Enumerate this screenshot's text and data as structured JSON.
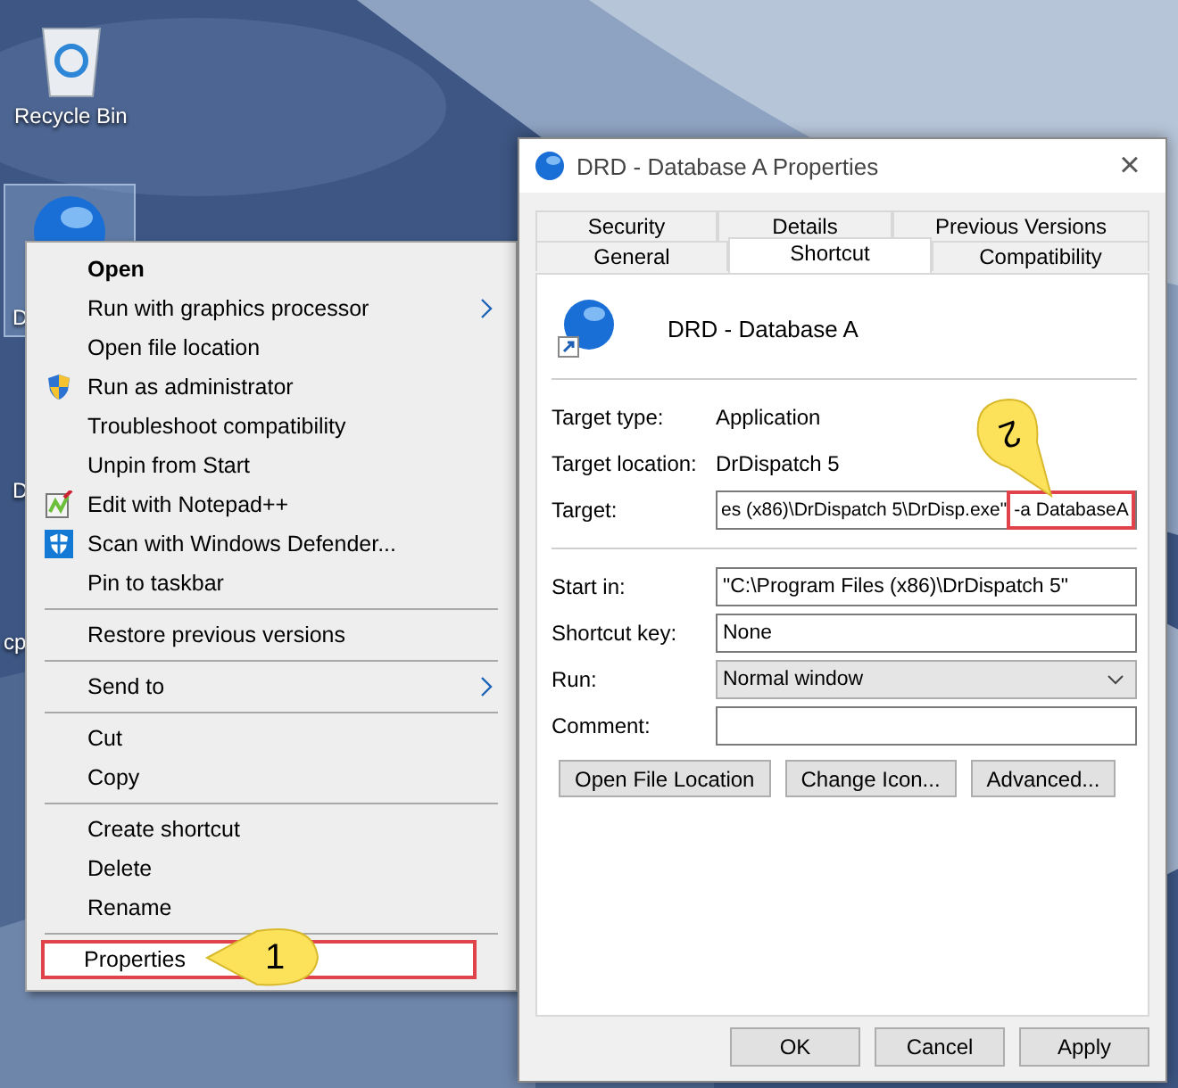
{
  "desktop": {
    "icons": [
      {
        "label": "Recycle Bin",
        "kind": "recycle"
      },
      {
        "label": "D",
        "kind": "drd",
        "selected": true
      },
      {
        "label": "D",
        "kind": "hidden"
      },
      {
        "label": "cp",
        "kind": "hidden"
      }
    ]
  },
  "context_menu": {
    "items": [
      {
        "kind": "item",
        "label": "Open",
        "default": true
      },
      {
        "kind": "item",
        "label": "Run with graphics processor",
        "submenu": true
      },
      {
        "kind": "item",
        "label": "Open file location"
      },
      {
        "kind": "shield",
        "label": "Run as administrator"
      },
      {
        "kind": "item",
        "label": "Troubleshoot compatibility"
      },
      {
        "kind": "item",
        "label": "Unpin from Start"
      },
      {
        "kind": "notepad",
        "label": "Edit with Notepad++"
      },
      {
        "kind": "defender",
        "label": "Scan with Windows Defender..."
      },
      {
        "kind": "item",
        "label": "Pin to taskbar"
      },
      {
        "kind": "separator"
      },
      {
        "kind": "item",
        "label": "Restore previous versions"
      },
      {
        "kind": "separator"
      },
      {
        "kind": "item",
        "label": "Send to",
        "submenu": true
      },
      {
        "kind": "separator"
      },
      {
        "kind": "item",
        "label": "Cut"
      },
      {
        "kind": "item",
        "label": "Copy"
      },
      {
        "kind": "separator"
      },
      {
        "kind": "item",
        "label": "Create shortcut"
      },
      {
        "kind": "item",
        "label": "Delete"
      },
      {
        "kind": "item",
        "label": "Rename"
      },
      {
        "kind": "separator"
      },
      {
        "kind": "item",
        "label": "Properties",
        "selected": true,
        "highlighted": true
      }
    ]
  },
  "dialog": {
    "title": "DRD - Database A Properties",
    "close": "×",
    "tab_rows": [
      [
        {
          "label": "Security",
          "selected": false
        },
        {
          "label": "Details",
          "selected": false
        },
        {
          "label": "Previous Versions",
          "selected": false
        }
      ],
      [
        {
          "label": "General",
          "selected": false
        },
        {
          "label": "Shortcut",
          "selected": true
        },
        {
          "label": "Compatibility",
          "selected": false
        }
      ]
    ],
    "name": "DRD - Database A",
    "info": [
      {
        "label": "Target type:",
        "value": "Application"
      },
      {
        "label": "Target location:",
        "value": "DrDispatch 5"
      }
    ],
    "target": {
      "label": "Target:",
      "value": "es (x86)\\DrDispatch 5\\DrDisp.exe\"",
      "argument": "-a DatabaseA",
      "highlighted": true
    },
    "fields": [
      {
        "label": "Start in:",
        "kind": "text",
        "value": "\"C:\\Program Files (x86)\\DrDispatch 5\""
      },
      {
        "label": "Shortcut key:",
        "kind": "text",
        "value": "None"
      },
      {
        "label": "Run:",
        "kind": "dropdown",
        "value": "Normal window"
      },
      {
        "label": "Comment:",
        "kind": "text"
      }
    ],
    "actions": [
      "Open File Location",
      "Change Icon...",
      "Advanced..."
    ],
    "buttons": [
      "OK",
      "Cancel",
      "Apply"
    ]
  },
  "annotations": [
    {
      "number": "1"
    },
    {
      "number": "2"
    }
  ]
}
